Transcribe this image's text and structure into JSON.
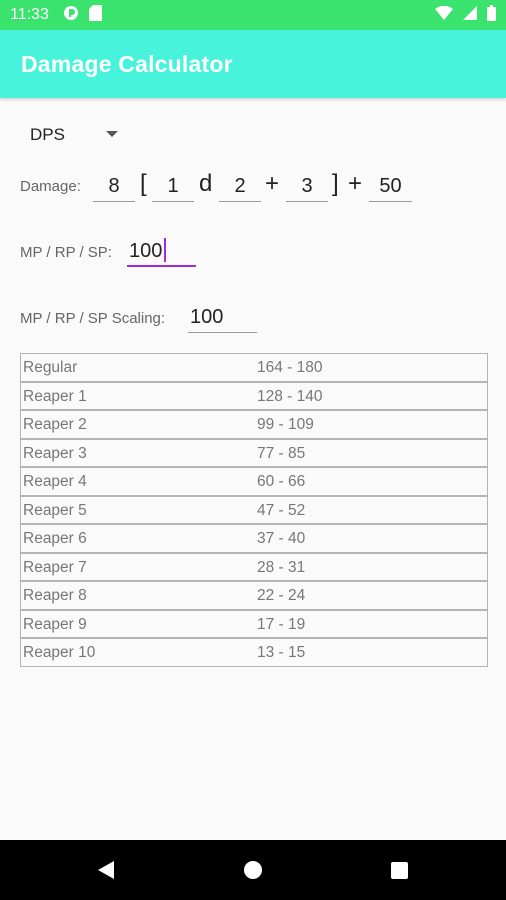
{
  "status_bar": {
    "time": "11:33",
    "icons_left": [
      "pocket-casts-icon",
      "sd-card-icon"
    ],
    "icons_right": [
      "wifi-icon",
      "cellular-icon",
      "battery-icon"
    ]
  },
  "app_bar": {
    "title": "Damage Calculator",
    "color": "#48f3dc"
  },
  "mode_spinner": {
    "selected": "DPS"
  },
  "damage": {
    "label": "Damage:",
    "multiplier": "8",
    "open_bracket": "[",
    "dice_count": "1",
    "d_symbol": "d",
    "dice_sides": "2",
    "plus_symbol": "+",
    "dice_bonus": "3",
    "close_bracket": "]",
    "plus_symbol_2": "+",
    "flat_bonus": "50"
  },
  "mp": {
    "label": "MP / RP / SP:",
    "value": "100"
  },
  "scaling": {
    "label": "MP / RP / SP Scaling:",
    "value": "100"
  },
  "results": [
    {
      "name": "Regular",
      "range": "164 - 180"
    },
    {
      "name": "Reaper 1",
      "range": "128 - 140"
    },
    {
      "name": "Reaper 2",
      "range": "99 - 109"
    },
    {
      "name": "Reaper 3",
      "range": "77 - 85"
    },
    {
      "name": "Reaper 4",
      "range": "60 - 66"
    },
    {
      "name": "Reaper 5",
      "range": "47 - 52"
    },
    {
      "name": "Reaper 6",
      "range": "37 - 40"
    },
    {
      "name": "Reaper 7",
      "range": "28 - 31"
    },
    {
      "name": "Reaper 8",
      "range": "22 - 24"
    },
    {
      "name": "Reaper 9",
      "range": "17 - 19"
    },
    {
      "name": "Reaper 10",
      "range": "13 - 15"
    }
  ],
  "accent_color": "#a22bd6"
}
